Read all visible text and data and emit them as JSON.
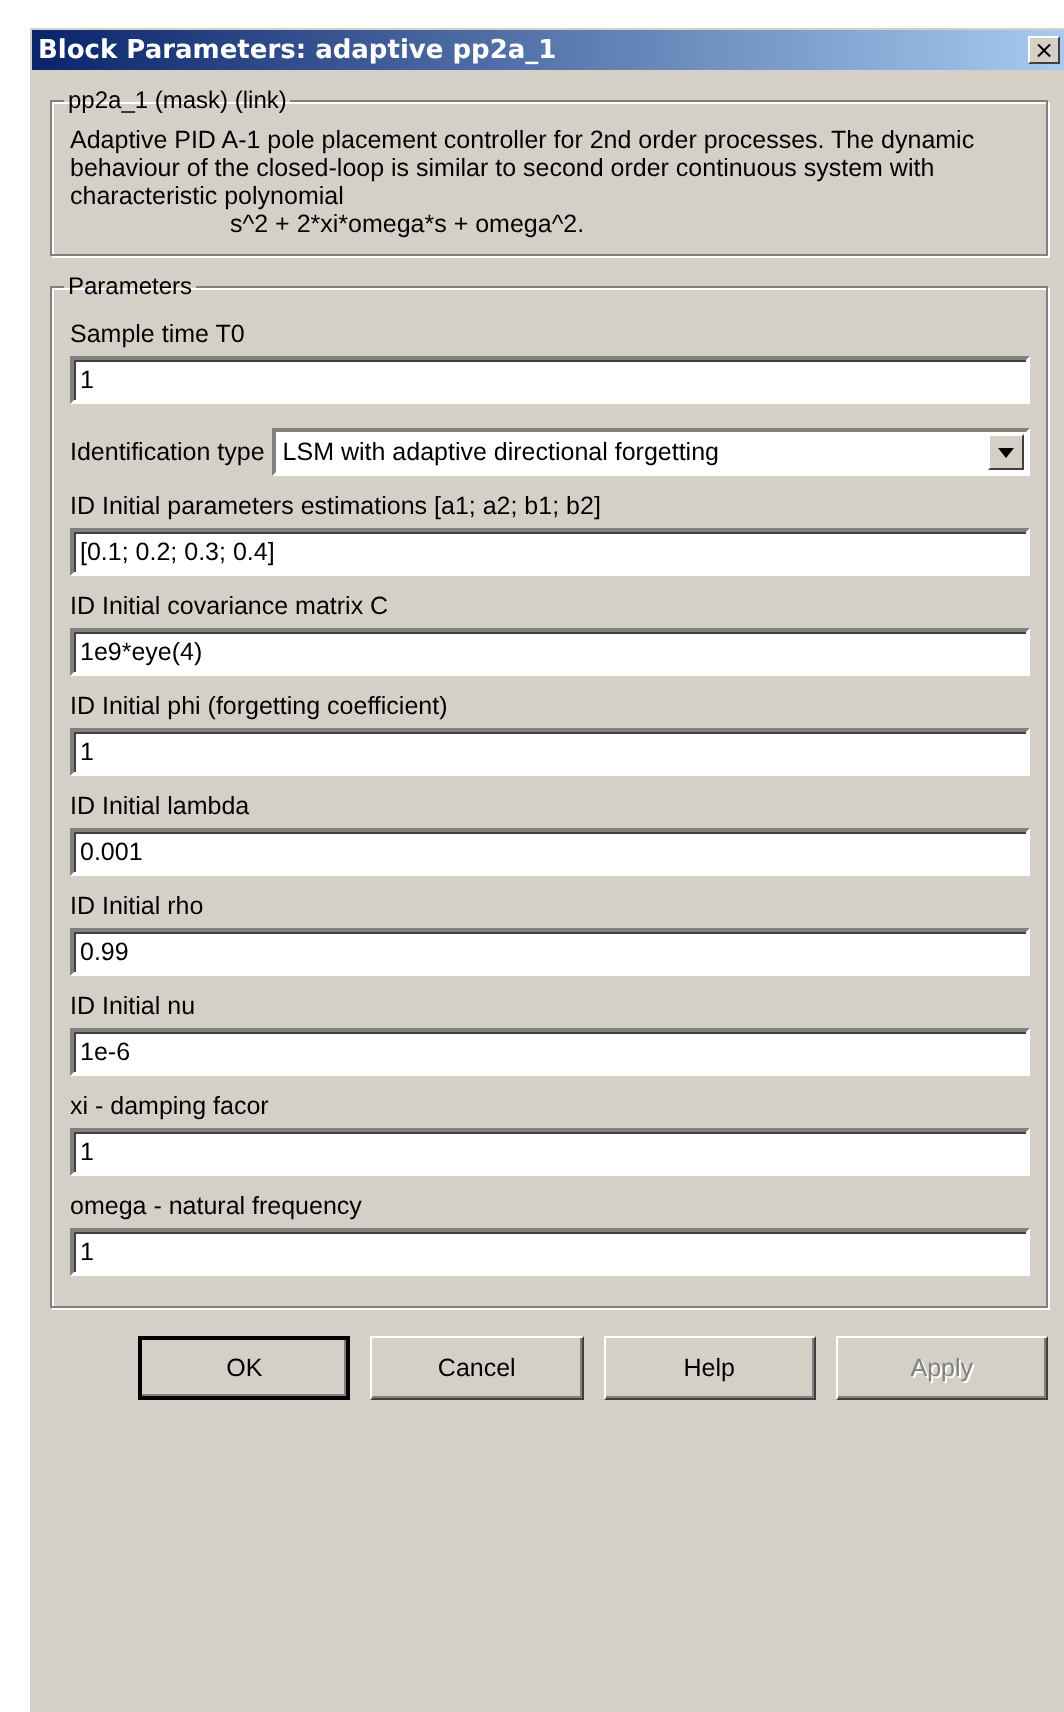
{
  "window": {
    "title": "Block Parameters: adaptive pp2a_1",
    "close": "×"
  },
  "mask": {
    "title": "pp2a_1 (mask) (link)",
    "description": "Adaptive PID A-1 pole placement controller for 2nd order processes. The dynamic behaviour of the closed-loop is similar to  second order continuous system with characteristic polynomial",
    "formula": "s^2 + 2*xi*omega*s + omega^2."
  },
  "parameters": {
    "title": "Parameters",
    "fields": [
      {
        "kind": "edit",
        "label": "Sample time T0",
        "value": "1"
      },
      {
        "kind": "popup",
        "label": "Identification type",
        "value": "LSM with adaptive directional forgetting"
      },
      {
        "kind": "edit",
        "label": "ID Initial parameters estimations [a1; a2; b1; b2]",
        "value": "[0.1; 0.2; 0.3; 0.4]"
      },
      {
        "kind": "edit",
        "label": "ID Initial covariance matrix C",
        "value": "1e9*eye(4)"
      },
      {
        "kind": "edit",
        "label": "ID Initial phi (forgetting coefficient)",
        "value": "1"
      },
      {
        "kind": "edit",
        "label": "ID Initial lambda",
        "value": "0.001"
      },
      {
        "kind": "edit",
        "label": "ID Initial rho",
        "value": "0.99"
      },
      {
        "kind": "edit",
        "label": "ID Initial nu",
        "value": "1e-6"
      },
      {
        "kind": "edit",
        "label": "xi - damping facor",
        "value": "1"
      },
      {
        "kind": "edit",
        "label": "omega - natural frequency",
        "value": "1"
      }
    ]
  },
  "buttons": [
    {
      "label": "OK",
      "default": true,
      "disabled": false
    },
    {
      "label": "Cancel",
      "default": false,
      "disabled": false
    },
    {
      "label": "Help",
      "default": false,
      "disabled": false
    },
    {
      "label": "Apply",
      "default": false,
      "disabled": true
    }
  ]
}
